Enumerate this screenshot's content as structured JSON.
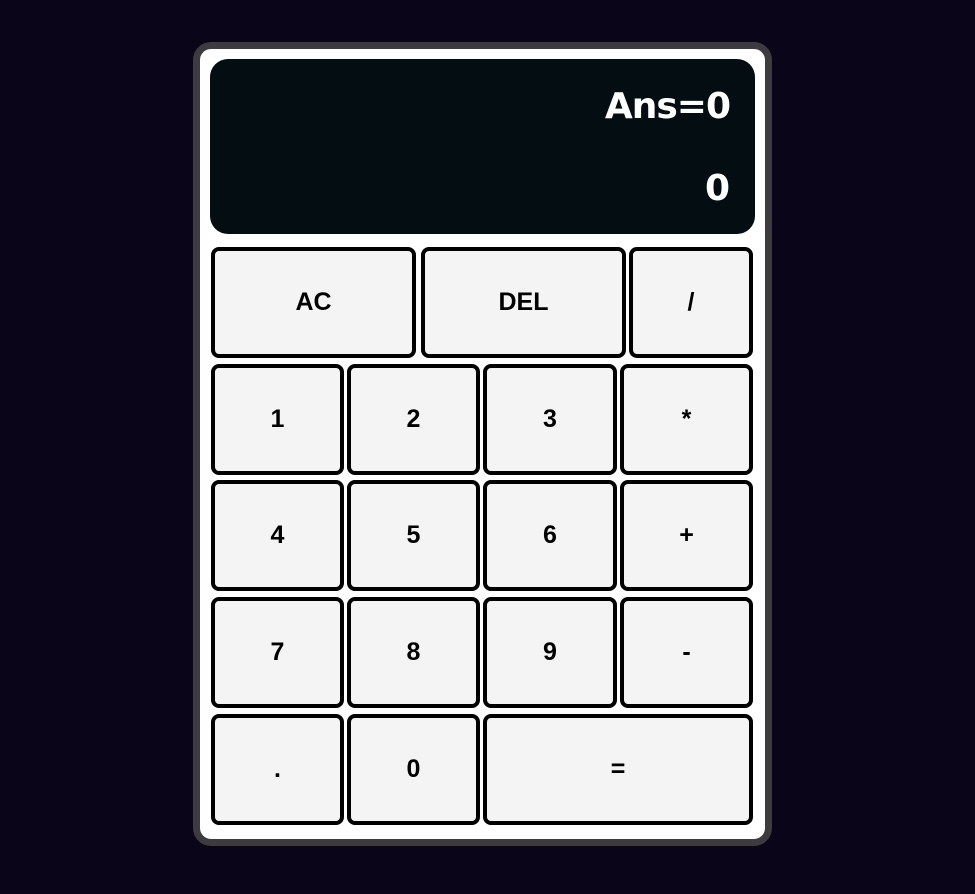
{
  "display": {
    "previous": "Ans=0",
    "current": "0"
  },
  "keys": {
    "ac": "AC",
    "del": "DEL",
    "divide": "/",
    "one": "1",
    "two": "2",
    "three": "3",
    "multiply": "*",
    "four": "4",
    "five": "5",
    "six": "6",
    "plus": "+",
    "seven": "7",
    "eight": "8",
    "nine": "9",
    "minus": "-",
    "dot": ".",
    "zero": "0",
    "equals": "="
  },
  "colors": {
    "background": "#0b0519",
    "frame": "#3d3a40",
    "display": "#040d12",
    "key": "#f4f4f4",
    "key_border": "#000000"
  }
}
